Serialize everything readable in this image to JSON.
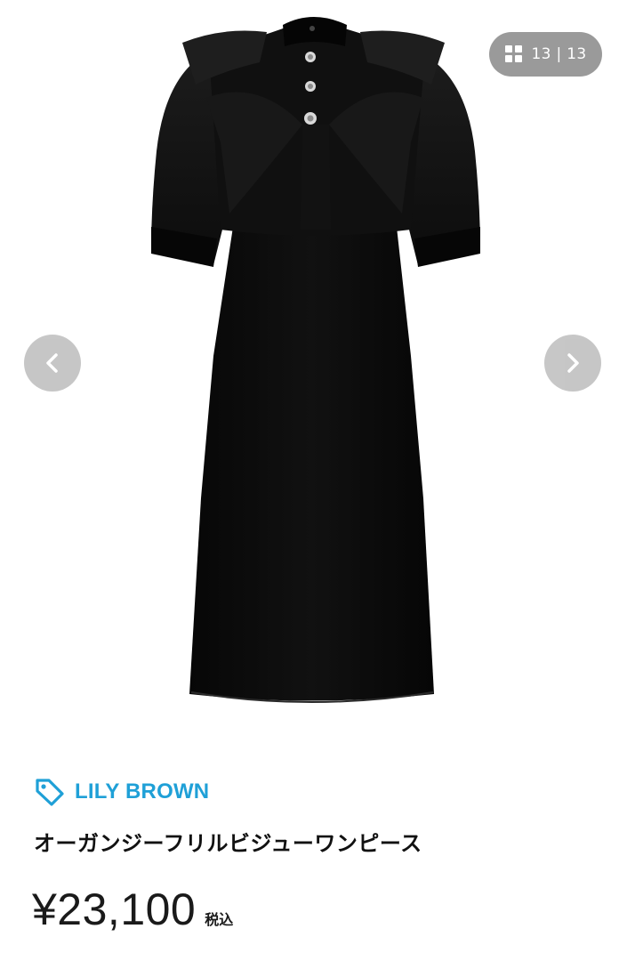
{
  "gallery": {
    "image_alt": "オーガンジーフリルビジューワンピース",
    "counter": {
      "current": "13",
      "separator": "|",
      "total": "13",
      "icon": "grid-icon"
    },
    "prev_icon": "chevron-left-icon",
    "next_icon": "chevron-right-icon"
  },
  "product": {
    "brand_icon": "tag-icon",
    "brand": "LILY BROWN",
    "title": "オーガンジーフリルビジューワンピース",
    "price": "¥23,100",
    "tax_label": "税込"
  },
  "colors": {
    "brand": "#1fa0d7",
    "counter_bg": "#9a9a9a",
    "nav_bg": "#c4c4c4",
    "dress": "#0b0b0b"
  }
}
